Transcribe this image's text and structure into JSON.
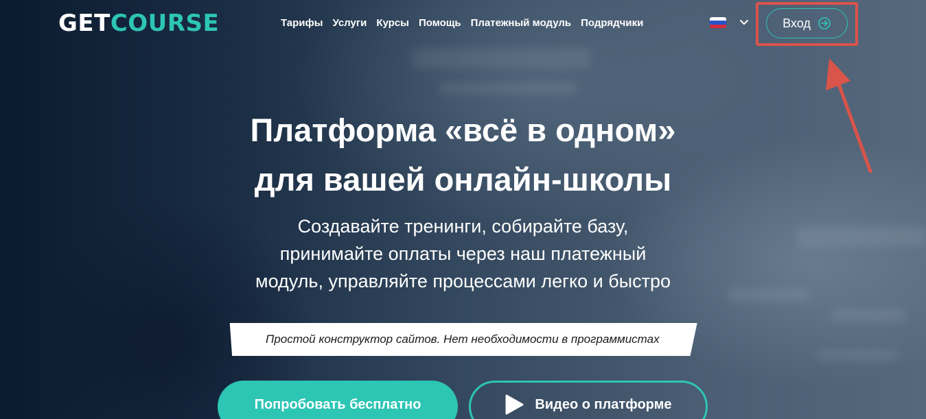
{
  "header": {
    "logo": {
      "part1": "GET",
      "part2": "COURSE"
    },
    "nav": [
      "Тарифы",
      "Услуги",
      "Курсы",
      "Помощь",
      "Платежный модуль",
      "Подрядчики"
    ],
    "language": {
      "flag_icon": "russia-flag-icon",
      "chevron_icon": "chevron-down-icon"
    },
    "login_label": "Вход",
    "login_icon": "arrow-right-circle-icon"
  },
  "hero": {
    "headline": [
      "Платформа «всё в одном»",
      "для вашей онлайн-школы"
    ],
    "subtext": [
      "Создавайте тренинги, собирайте базу,",
      "принимайте оплаты через наш платежный",
      "модуль, управляйте процессами легко и быстро"
    ],
    "tagline": "Простой конструктор сайтов. Нет необходимости в программистах",
    "try_button": "Попробовать бесплатно",
    "video_button": "Видео о платформе",
    "video_icon": "play-icon"
  },
  "colors": {
    "accent": "#2dc5b4",
    "annotation": "#d9544a",
    "text": "#ffffff"
  }
}
